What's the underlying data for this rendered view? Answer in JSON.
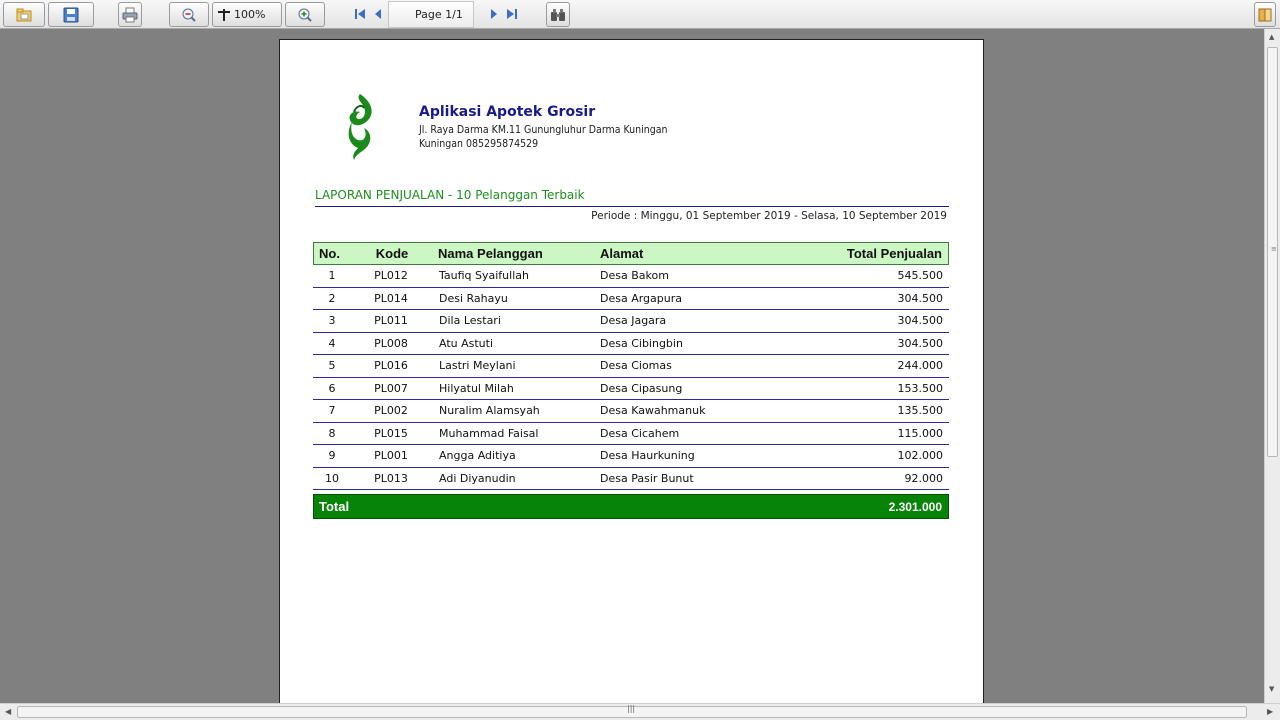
{
  "toolbar": {
    "zoom": "100%",
    "page": "Page 1/1"
  },
  "report": {
    "company_name": "Aplikasi Apotek Grosir",
    "address_line1": "Jl. Raya Darma KM.11 Gunungluhur Darma Kuningan",
    "address_line2": "Kuningan 085295874529",
    "title": "LAPORAN PENJUALAN - 10 Pelanggan Terbaik",
    "period": "Periode : Minggu, 01 September 2019 - Selasa, 10 September 2019",
    "columns": [
      "No.",
      "Kode",
      "Nama Pelanggan",
      "Alamat",
      "Total Penjualan"
    ],
    "rows": [
      {
        "no": "1",
        "kode": "PL012",
        "nama": "Taufiq Syaifullah",
        "alamat": "Desa Bakom",
        "total": "545.500"
      },
      {
        "no": "2",
        "kode": "PL014",
        "nama": "Desi Rahayu",
        "alamat": "Desa Argapura",
        "total": "304.500"
      },
      {
        "no": "3",
        "kode": "PL011",
        "nama": "Dila Lestari",
        "alamat": "Desa Jagara",
        "total": "304.500"
      },
      {
        "no": "4",
        "kode": "PL008",
        "nama": "Atu Astuti",
        "alamat": "Desa Cibingbin",
        "total": "304.500"
      },
      {
        "no": "5",
        "kode": "PL016",
        "nama": "Lastri Meylani",
        "alamat": "Desa Ciomas",
        "total": "244.000"
      },
      {
        "no": "6",
        "kode": "PL007",
        "nama": "Hilyatul Milah",
        "alamat": "Desa Cipasung",
        "total": "153.500"
      },
      {
        "no": "7",
        "kode": "PL002",
        "nama": "Nuralim Alamsyah",
        "alamat": "Desa Kawahmanuk",
        "total": "135.500"
      },
      {
        "no": "8",
        "kode": "PL015",
        "nama": "Muhammad Faisal",
        "alamat": "Desa Cicahem",
        "total": "115.000"
      },
      {
        "no": "9",
        "kode": "PL001",
        "nama": "Angga Aditiya",
        "alamat": "Desa Haurkuning",
        "total": "102.000"
      },
      {
        "no": "10",
        "kode": "PL013",
        "nama": "Adi Diyanudin",
        "alamat": "Desa Pasir Bunut",
        "total": "92.000"
      }
    ],
    "total_label": "Total",
    "total_value": "2.301.000"
  },
  "colors": {
    "header_bg": "#ccf7c4",
    "total_bg": "#078407",
    "company_name": "#1a1a8c",
    "title_green": "#1e8f1e"
  },
  "icons": [
    "open-icon",
    "save-icon",
    "print-icon",
    "zoom-out-icon",
    "zoom-fit-icon",
    "zoom-in-icon",
    "first-page-icon",
    "previous-page-icon",
    "next-page-icon",
    "last-page-icon",
    "find-icon",
    "export-icon"
  ]
}
